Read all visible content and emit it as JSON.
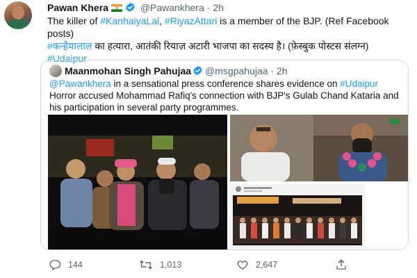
{
  "author": {
    "name": "Pawan Khera",
    "flag_icon": "india-flag-icon",
    "handle": "@Pawankhera",
    "separator": "·",
    "time": "2h"
  },
  "tweet": {
    "line1_prefix": "The killer of ",
    "hashtag_1": "#KanhaiyaLal",
    "comma": ", ",
    "hashtag_2": "#RiyazAttari",
    "line1_suffix": " is a member of the BJP. (Ref Facebook posts)",
    "hindi_hashtag": "#कन्हैयालाल",
    "hindi_text": " का हत्यारा, आतंकी रियाज़ अटारी भाजपा का सदस्य है। (फ़ेस्बुक पोस्टस संलग्न) ",
    "hashtag_3": "#Udaipur"
  },
  "quoted": {
    "name": "Maanmohan Singh Pahujaa",
    "handle": "@msgpahujaa",
    "separator": "·",
    "time": "2h",
    "mention": "@Pawankhera",
    "text_1": " in a sensational press conference shares evidence on ",
    "hashtag": "#Udaipur",
    "text_2": " Horror accused Mohammad Rafiq's connection with BJP's Gulab Chand Kataria and his participation in several party programmes."
  },
  "actions": {
    "replies": "144",
    "retweets": "1,013",
    "likes": "2,647",
    "icons": [
      "reply-icon",
      "retweet-icon",
      "like-icon",
      "share-icon"
    ]
  },
  "colors": {
    "link": "#1d9bf0",
    "muted": "#536471",
    "border": "#cfd9de",
    "verified": "#1d9bf0"
  }
}
